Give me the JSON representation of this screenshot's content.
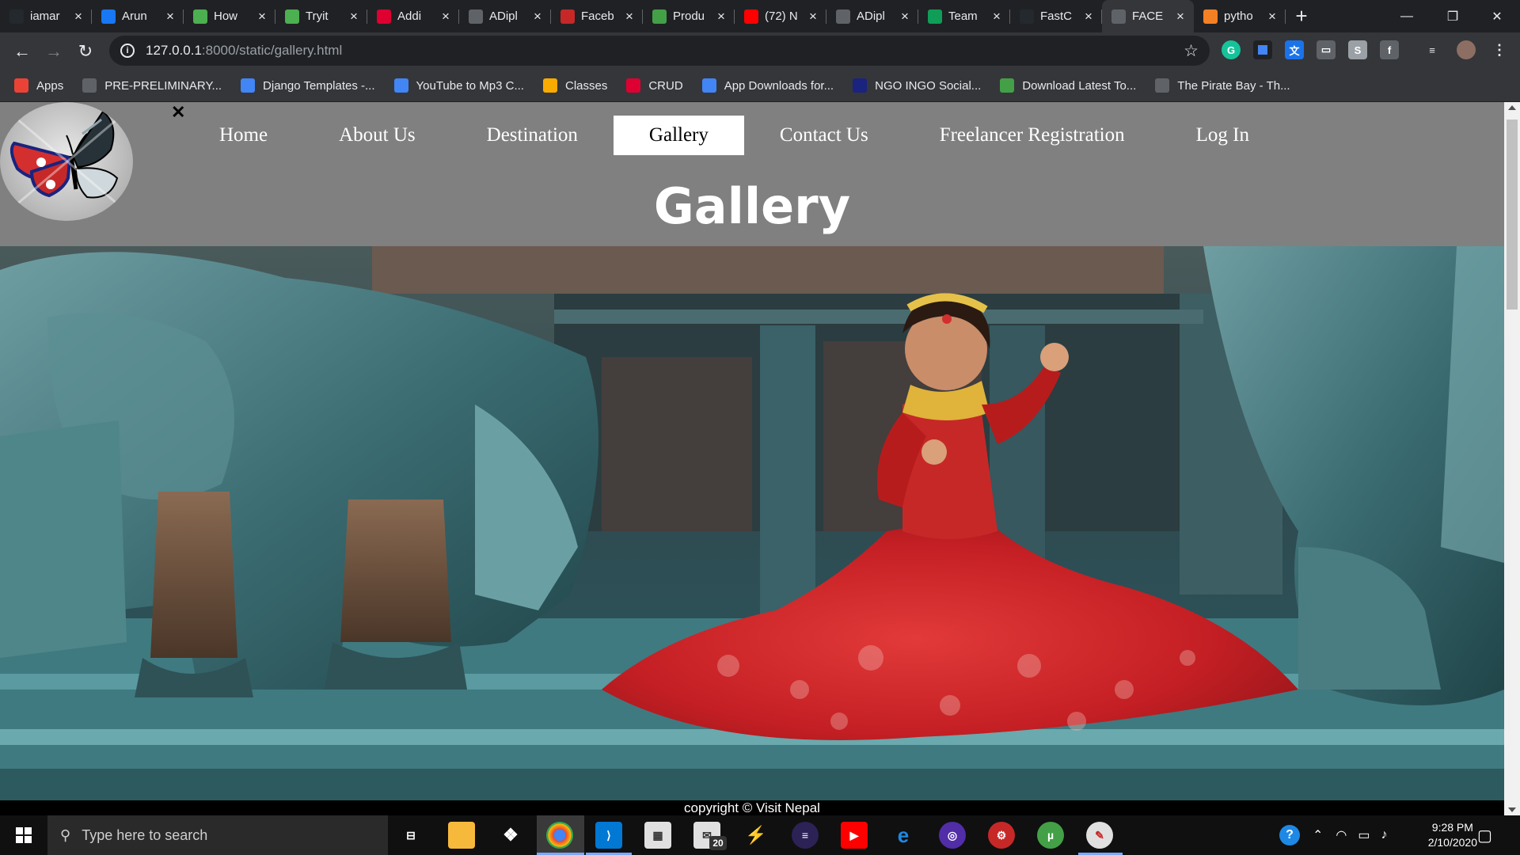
{
  "browser": {
    "tabs": [
      {
        "label": "iamar",
        "icon": "github-icon",
        "color": "#24292e"
      },
      {
        "label": "Arun",
        "icon": "facebook-icon",
        "color": "#1877f2"
      },
      {
        "label": "How",
        "icon": "w3-icon",
        "color": "#4caf50"
      },
      {
        "label": "Tryit",
        "icon": "w3-icon",
        "color": "#4caf50"
      },
      {
        "label": "Addi",
        "icon": "angular-icon",
        "color": "#dd0031"
      },
      {
        "label": "ADipl",
        "icon": "globe-icon",
        "color": "#5f6368"
      },
      {
        "label": "Faceb",
        "icon": "store-icon",
        "color": "#c62828"
      },
      {
        "label": "Produ",
        "icon": "leaf-icon",
        "color": "#43a047"
      },
      {
        "label": "(72) N",
        "icon": "youtube-icon",
        "color": "#ff0000"
      },
      {
        "label": "ADipl",
        "icon": "document-icon",
        "color": "#5f6368"
      },
      {
        "label": "Team",
        "icon": "plus-icon",
        "color": "#0f9d58"
      },
      {
        "label": "FastC",
        "icon": "github-icon",
        "color": "#24292e"
      },
      {
        "label": "FACE",
        "icon": "globe-icon",
        "color": "#5f6368",
        "active": true
      },
      {
        "label": "pytho",
        "icon": "stackoverflow-icon",
        "color": "#f48024"
      }
    ],
    "url": {
      "host": "127.0.0.1",
      "path": ":8000/static/gallery.html"
    },
    "bookmarks": [
      {
        "label": "Apps",
        "icon": "apps-grid-icon",
        "color": "#ea4335"
      },
      {
        "label": "PRE-PRELIMINARY...",
        "icon": "globe-icon",
        "color": "#5f6368"
      },
      {
        "label": "Django Templates -...",
        "icon": "django-icon",
        "color": "#4285f4"
      },
      {
        "label": "YouTube to Mp3 C...",
        "icon": "cloud-icon",
        "color": "#4285f4"
      },
      {
        "label": "Classes",
        "icon": "classroom-icon",
        "color": "#f9ab00"
      },
      {
        "label": "CRUD",
        "icon": "angular-icon",
        "color": "#dd0031"
      },
      {
        "label": "App Downloads for...",
        "icon": "download-icon",
        "color": "#4285f4"
      },
      {
        "label": "NGO INGO Social...",
        "icon": "ngo-icon",
        "color": "#1a237e"
      },
      {
        "label": "Download Latest To...",
        "icon": "utorrent-icon",
        "color": "#43a047"
      },
      {
        "label": "The Pirate Bay - Th...",
        "icon": "monitor-icon",
        "color": "#5f6368"
      }
    ]
  },
  "site": {
    "close_symbol": "✕",
    "nav": [
      {
        "label": "Home"
      },
      {
        "label": "About Us"
      },
      {
        "label": "Destination"
      },
      {
        "label": "Gallery",
        "active": true
      },
      {
        "label": "Contact Us"
      },
      {
        "label": "Freelancer Registration"
      },
      {
        "label": "Log In"
      }
    ],
    "title": "Gallery",
    "footer": "copyright © Visit Nepal"
  },
  "taskbar": {
    "search_placeholder": "Type here to search",
    "mail_badge": "20",
    "time": "9:28 PM",
    "date": "2/10/2020"
  },
  "colors": {
    "page_bg": "#808080",
    "nav_active_bg": "#ffffff",
    "footer_bg": "#000000"
  }
}
